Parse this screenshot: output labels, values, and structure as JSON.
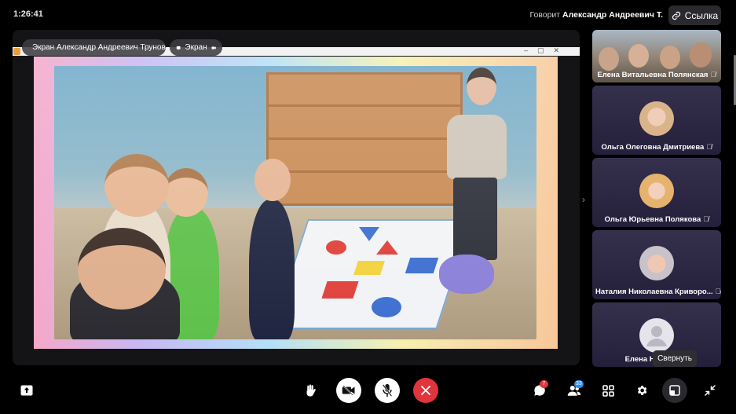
{
  "header": {
    "timer": "1:26:41",
    "speaker_prefix": "Говорит",
    "speaker_name": "Александр Андреевич Т.",
    "link_label": "Ссылка"
  },
  "stage": {
    "screen_owner_pill": "Экран Александр Андреевич Трунов",
    "screen_pill": "Экран"
  },
  "participants": [
    {
      "name": "Елена Витальевна Полянская",
      "avatar": "group-photo",
      "muted": true
    },
    {
      "name": "Ольга Олеговна Дмитриева",
      "avatar": "woman-photo",
      "muted": true
    },
    {
      "name": "Ольга Юрьевна Полякова",
      "avatar": "woman-photo",
      "muted": true
    },
    {
      "name": "Наталия Николаевна Криворо...",
      "avatar": "woman-photo",
      "muted": true
    },
    {
      "name": "Елена Николае",
      "avatar": "default-user-icon",
      "muted": true
    }
  ],
  "tooltip": "Свернуть",
  "toolbar": {
    "chat_badge": "7",
    "participants_badge": "33"
  },
  "colors": {
    "end_call": "#e0353c",
    "camera_off_bg": "#ffffff",
    "badge": "#2e8cf0",
    "chat_badge": "#e0353c"
  }
}
